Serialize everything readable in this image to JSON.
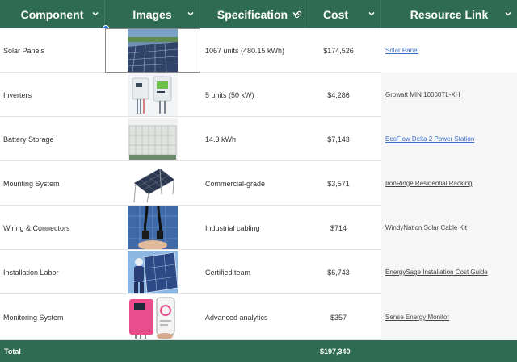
{
  "header": {
    "columns": [
      {
        "label": "Component"
      },
      {
        "label": "Images"
      },
      {
        "label": "Specification"
      },
      {
        "label": "Cost"
      },
      {
        "label": "Resource Link"
      }
    ]
  },
  "rows": [
    {
      "component": "Solar Panels",
      "image": "solar-panel-photo",
      "spec": "1067 units (480.15 kWh)",
      "cost": "$174,526",
      "link": "Solar Panel",
      "link_color": "#3a6fc9"
    },
    {
      "component": "Inverters",
      "image": "inverter-photo",
      "spec": "5 units (50 kW)",
      "cost": "$4,286",
      "link": "Growatt MIN 10000TL-XH",
      "link_color": "#444444"
    },
    {
      "component": "Battery Storage",
      "image": "battery-photo",
      "spec": "14.3 kWh",
      "cost": "$7,143",
      "link": " EcoFlow Delta 2 Power Station",
      "link_color": "#3a6fc9"
    },
    {
      "component": "Mounting System",
      "image": "mounting-photo",
      "spec": "Commercial-grade",
      "cost": "$3,571",
      "link": "IronRidge Residential Racking",
      "link_color": "#444444"
    },
    {
      "component": "Wiring & Connectors",
      "image": "wiring-photo",
      "spec": "Industrial cabling",
      "cost": "$714",
      "link": "WindyNation Solar Cable Kit",
      "link_color": "#444444"
    },
    {
      "component": "Installation Labor",
      "image": "installer-photo",
      "spec": "Certified team",
      "cost": "$6,743",
      "link": "EnergySage Installation Cost Guide",
      "link_color": "#444444"
    },
    {
      "component": "Monitoring System",
      "image": "monitor-photo",
      "spec": "Advanced analytics",
      "cost": "$357",
      "link": "Sense Energy Monitor",
      "link_color": "#444444"
    }
  ],
  "total": {
    "label": "Total",
    "value": "$197,340"
  },
  "colors": {
    "header_bg": "#2f6b52",
    "link_blue": "#3a6fc9",
    "selection": "#1a73e8"
  }
}
